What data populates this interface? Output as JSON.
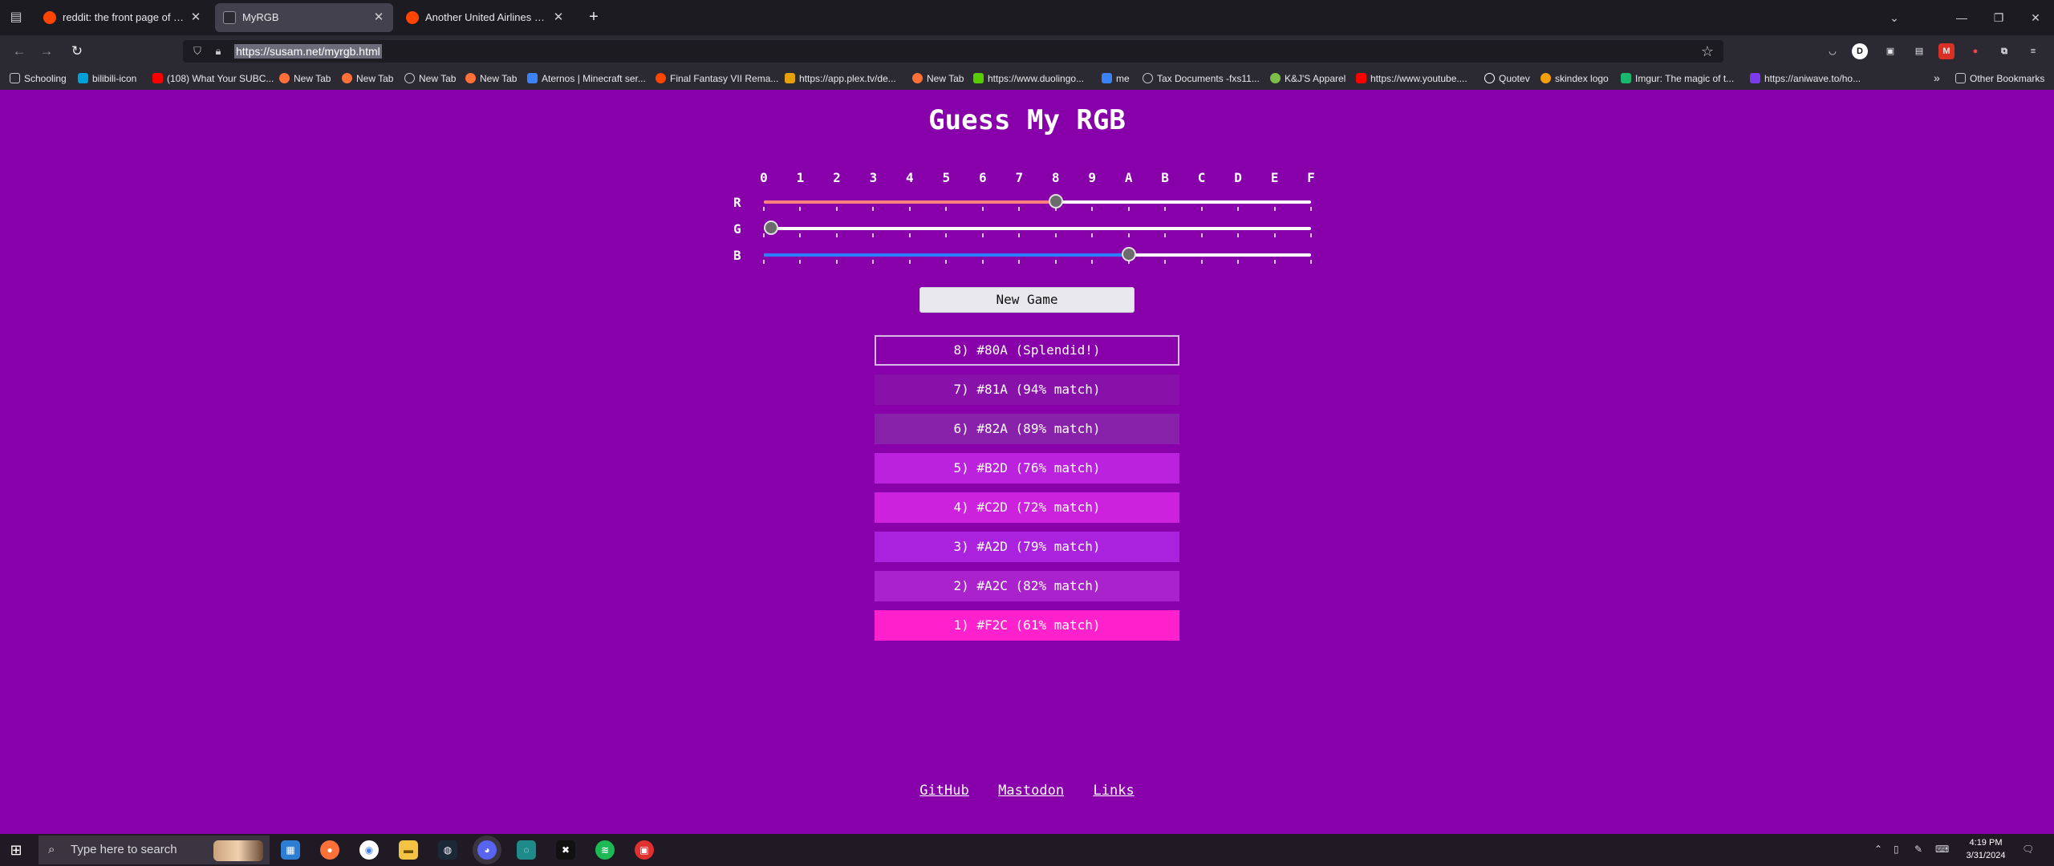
{
  "browser": {
    "tabs": [
      {
        "label": "reddit: the front page of the internet",
        "active": false,
        "favicon_color": "#ff4500"
      },
      {
        "label": "MyRGB",
        "active": true,
        "favicon_color": "#2b2a33"
      },
      {
        "label": "Another United Airlines plane has",
        "active": false,
        "favicon_color": "#ff4500"
      }
    ],
    "url": "https://susam.net/myrgb.html",
    "bookmarks": [
      {
        "label": "Schooling",
        "color": "#c8c8cc"
      },
      {
        "label": "bilibili-icon",
        "color": "#00a1d6"
      },
      {
        "label": "(108) What Your SUBC...",
        "color": "#ff0000"
      },
      {
        "label": "New Tab",
        "color": "#ff7139"
      },
      {
        "label": "New Tab",
        "color": "#ff7139"
      },
      {
        "label": "New Tab",
        "color": "#c8c8cc"
      },
      {
        "label": "New Tab",
        "color": "#ff7139"
      },
      {
        "label": "Aternos | Minecraft ser...",
        "color": "#3b82f6"
      },
      {
        "label": "Final Fantasy VII Rema...",
        "color": "#ff4500"
      },
      {
        "label": "https://app.plex.tv/de...",
        "color": "#e5a00d"
      },
      {
        "label": "New Tab",
        "color": "#ff7139"
      },
      {
        "label": "https://www.duolingo...",
        "color": "#58cc02"
      },
      {
        "label": "me",
        "color": "#3b82f6"
      },
      {
        "label": "Tax Documents -fxs11...",
        "color": "#c8c8cc"
      },
      {
        "label": "K&J'S Apparel",
        "color": "#7bbf4a"
      },
      {
        "label": "https://www.youtube....",
        "color": "#ff0000"
      },
      {
        "label": "Quotev",
        "color": "#ffffff"
      },
      {
        "label": "skindex logo",
        "color": "#f59e0b"
      },
      {
        "label": "Imgur: The magic of t...",
        "color": "#1bb76e"
      },
      {
        "label": "https://aniwave.to/ho...",
        "color": "#7c3aed"
      }
    ],
    "other_bookmarks": "Other Bookmarks"
  },
  "game": {
    "title": "Guess My RGB",
    "hex_digits": [
      "0",
      "1",
      "2",
      "3",
      "4",
      "5",
      "6",
      "7",
      "8",
      "9",
      "A",
      "B",
      "C",
      "D",
      "E",
      "F"
    ],
    "channels": [
      {
        "label": "R",
        "value": 8,
        "fill_color": "#ff7f7f"
      },
      {
        "label": "G",
        "value": 0,
        "fill_color": "#7fff7f"
      },
      {
        "label": "B",
        "value": 10,
        "fill_color": "#2b7fff"
      }
    ],
    "new_game_label": "New Game",
    "guesses": [
      {
        "text": "8) #80A (Splendid!)",
        "color": "#8800aa"
      },
      {
        "text": "7) #81A (94% match)",
        "color": "#8811aa"
      },
      {
        "text": "6) #82A (89% match)",
        "color": "#8822aa"
      },
      {
        "text": "5) #B2D (76% match)",
        "color": "#bb22dd"
      },
      {
        "text": "4) #C2D (72% match)",
        "color": "#cc22dd"
      },
      {
        "text": "3) #A2D (79% match)",
        "color": "#aa22dd"
      },
      {
        "text": "2) #A2C (82% match)",
        "color": "#aa22cc"
      },
      {
        "text": "1) #F2C (61% match)",
        "color": "#ff22cc"
      }
    ]
  },
  "footer": {
    "links": [
      "GitHub",
      "Mastodon",
      "Links"
    ]
  },
  "taskbar": {
    "search_placeholder": "Type here to search",
    "time": "4:19 PM",
    "date": "3/31/2024"
  }
}
